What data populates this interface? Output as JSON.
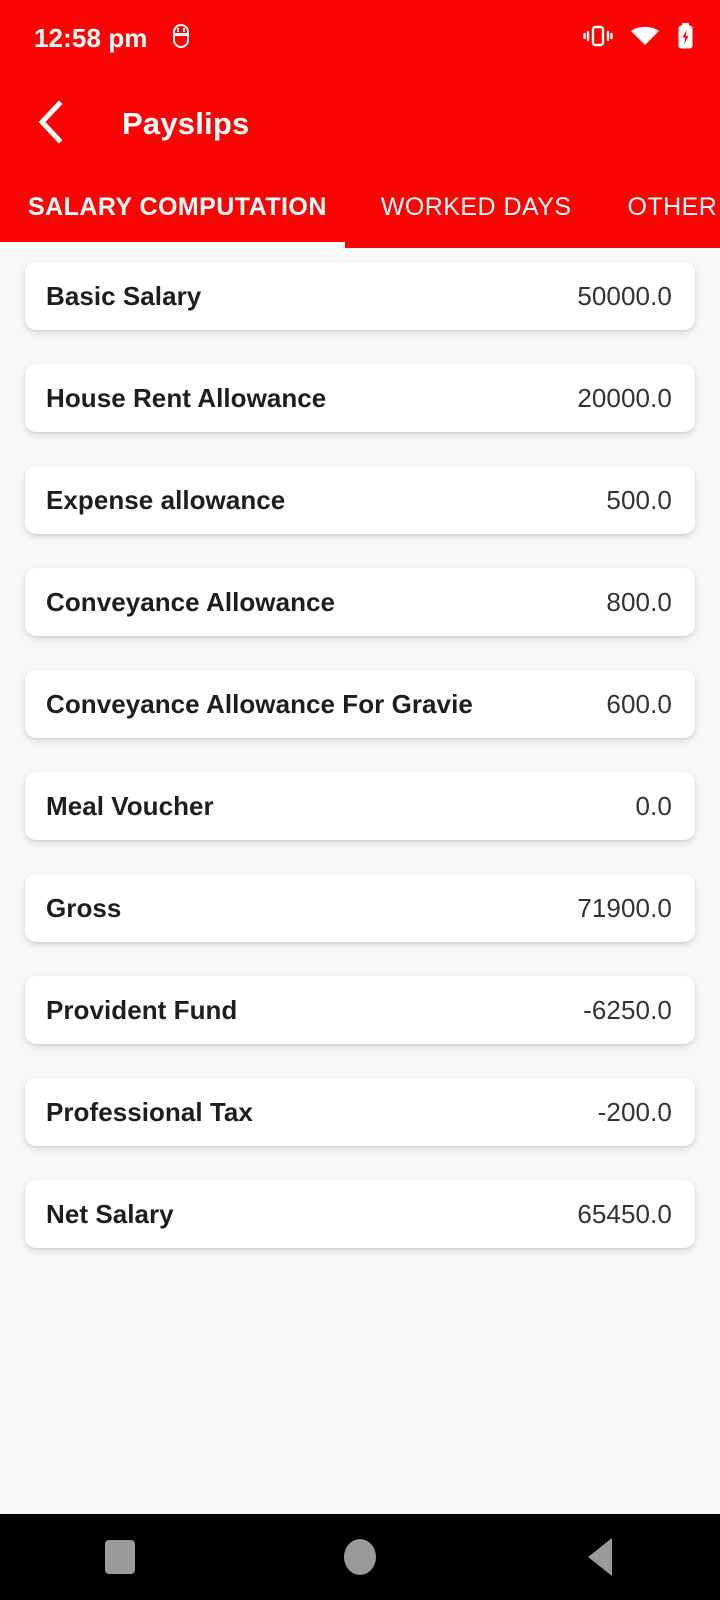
{
  "status_bar": {
    "time": "12:58 pm",
    "icons": [
      "bug-notification-icon",
      "vibrate-icon",
      "wifi-icon",
      "battery-charging-icon"
    ]
  },
  "app_bar": {
    "back_icon": "chevron-left-icon",
    "title": "Payslips"
  },
  "tabs": {
    "items": [
      {
        "label": "SALARY COMPUTATION",
        "active": true
      },
      {
        "label": "WORKED DAYS",
        "active": false
      },
      {
        "label": "OTHER",
        "active": false
      }
    ]
  },
  "salary_rows": [
    {
      "label": "Basic Salary",
      "value": "50000.0"
    },
    {
      "label": "House Rent Allowance",
      "value": "20000.0"
    },
    {
      "label": "Expense allowance",
      "value": "500.0"
    },
    {
      "label": "Conveyance Allowance",
      "value": "800.0"
    },
    {
      "label": "Conveyance Allowance For Gravie",
      "value": "600.0"
    },
    {
      "label": "Meal Voucher",
      "value": "0.0"
    },
    {
      "label": "Gross",
      "value": "71900.0"
    },
    {
      "label": "Provident Fund",
      "value": "-6250.0"
    },
    {
      "label": "Professional Tax",
      "value": "-200.0"
    },
    {
      "label": "Net Salary",
      "value": "65450.0"
    }
  ],
  "nav_bar": {
    "recents_icon": "square-recents-icon",
    "home_icon": "circle-home-icon",
    "back_icon": "triangle-back-icon"
  },
  "colors": {
    "brand_red": "#fb0404",
    "page_background": "#f8f8f8",
    "card_background": "#ffffff",
    "label_text": "#1e1e1e",
    "value_text": "#333333",
    "nav_icon": "#9a9a9a"
  }
}
